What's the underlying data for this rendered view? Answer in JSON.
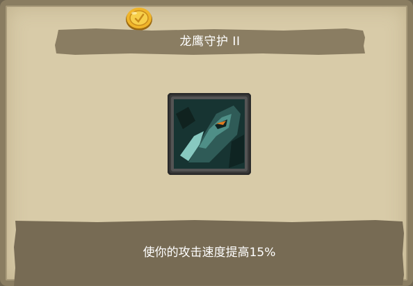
{
  "skill": {
    "title": "龙鹰守护 II",
    "description": "使你的攻击速度提高15%",
    "icon": "dragon-hawk-icon"
  },
  "currency": {
    "icon": "gold-coin-icon"
  },
  "colors": {
    "parchment": "#d8cba8",
    "banner": "#8a7d62",
    "frame_border": "#8a7d61",
    "text": "#ffffff",
    "icon_teal": "#2f5b57",
    "icon_eye": "#e07a1f"
  }
}
